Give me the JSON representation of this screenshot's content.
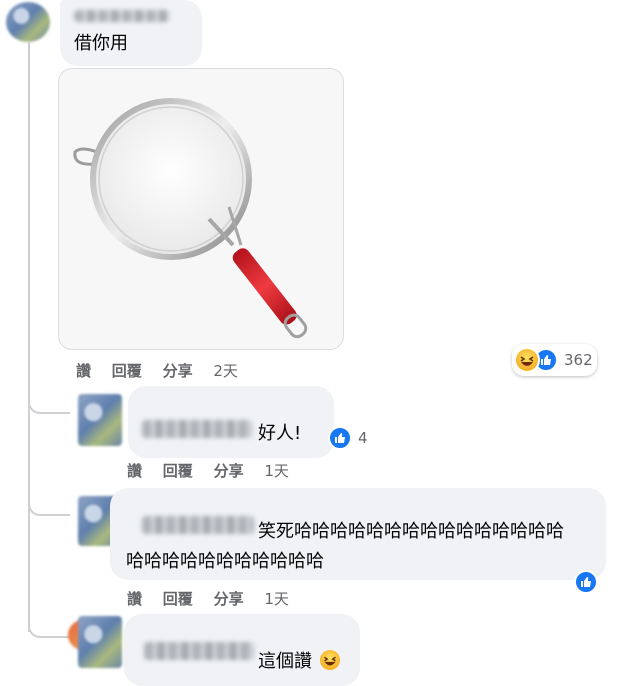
{
  "comments": [
    {
      "text": "借你用",
      "actions": {
        "like": "讚",
        "reply": "回覆",
        "share": "分享",
        "time": "2天"
      },
      "reactions": {
        "count": "362",
        "icons": [
          "haha-icon",
          "like-icon"
        ]
      }
    },
    {
      "text": "好人!",
      "actions": {
        "like": "讚",
        "reply": "回覆",
        "share": "分享",
        "time": "1天"
      },
      "reactions": {
        "count": "4",
        "icons": [
          "like-icon"
        ]
      }
    },
    {
      "text_line1": "笑死哈哈哈哈哈哈哈哈哈哈哈哈哈哈哈",
      "text_line2": "哈哈哈哈哈哈哈哈哈哈哈",
      "actions": {
        "like": "讚",
        "reply": "回覆",
        "share": "分享",
        "time": "1天"
      },
      "reactions": {
        "icons": [
          "like-icon"
        ]
      }
    },
    {
      "text": "這個讚",
      "emoji": "haha-icon"
    }
  ],
  "colors": {
    "accent": "#1877f2",
    "bubble": "#f0f2f5",
    "secondary_text": "#65676b",
    "strainer_handle": "#d4232b"
  }
}
